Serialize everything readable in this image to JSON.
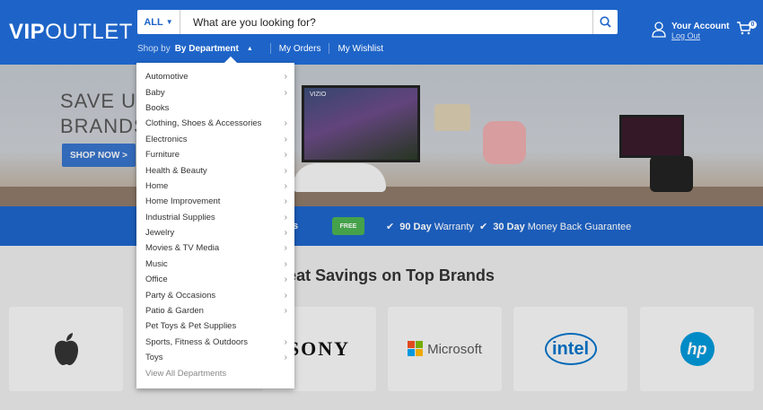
{
  "logo": {
    "bold": "VIP",
    "light": "OUTLET"
  },
  "search": {
    "scope_label": "ALL",
    "placeholder": "What are you looking for?"
  },
  "subnav": {
    "shop_by": "Shop by",
    "department": "By Department",
    "orders": "My Orders",
    "wishlist": "My Wishlist"
  },
  "account": {
    "title": "Your Account",
    "logout": "Log Out",
    "cart_count": "0"
  },
  "hero": {
    "line1": "SAVE UP",
    "line2": "BRANDS",
    "cta": "SHOP NOW >",
    "tv_brand": "VIZIO"
  },
  "promo": {
    "free_badge": "FREE",
    "left_fragment": "s",
    "warranty_bold": "90 Day",
    "warranty": "Warranty",
    "guarantee_bold": "30 Day",
    "guarantee": "Money Back Guarantee"
  },
  "brands": {
    "title": "Great Savings on Top Brands",
    "items": [
      "Apple",
      "SONY",
      "Microsoft",
      "intel",
      "hp"
    ]
  },
  "menu": {
    "items": [
      {
        "label": "Automotive",
        "has_sub": true
      },
      {
        "label": "Baby",
        "has_sub": true
      },
      {
        "label": "Books",
        "has_sub": false
      },
      {
        "label": "Clothing, Shoes & Accessories",
        "has_sub": true
      },
      {
        "label": "Electronics",
        "has_sub": true
      },
      {
        "label": "Furniture",
        "has_sub": true
      },
      {
        "label": "Health & Beauty",
        "has_sub": true
      },
      {
        "label": "Home",
        "has_sub": true
      },
      {
        "label": "Home Improvement",
        "has_sub": true
      },
      {
        "label": "Industrial Supplies",
        "has_sub": true
      },
      {
        "label": "Jewelry",
        "has_sub": true
      },
      {
        "label": "Movies & TV Media",
        "has_sub": true
      },
      {
        "label": "Music",
        "has_sub": true
      },
      {
        "label": "Office",
        "has_sub": true
      },
      {
        "label": "Party & Occasions",
        "has_sub": true
      },
      {
        "label": "Patio & Garden",
        "has_sub": true
      },
      {
        "label": "Pet Toys & Pet Supplies",
        "has_sub": false
      },
      {
        "label": "Sports, Fitness & Outdoors",
        "has_sub": true
      },
      {
        "label": "Toys",
        "has_sub": true
      }
    ],
    "view_all": "View All Departments"
  },
  "colors": {
    "brand_blue": "#1e64c8",
    "free_green": "#4caf50"
  }
}
